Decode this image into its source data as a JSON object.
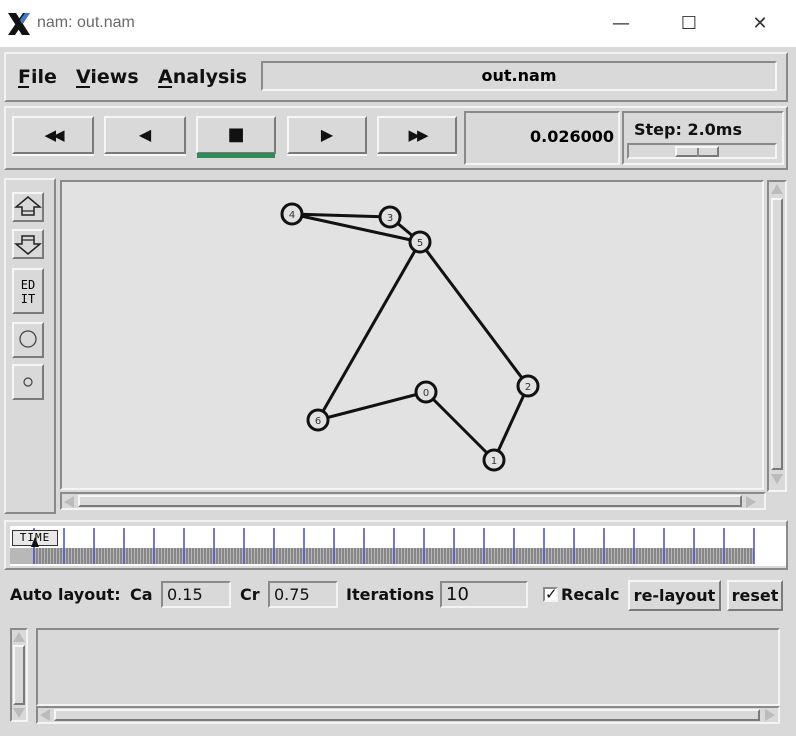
{
  "window": {
    "title": "nam: out.nam",
    "icon": "x-logo-icon",
    "minimize": "—",
    "maximize": "☐",
    "close": "✕"
  },
  "menu": {
    "file": "File",
    "views": "Views",
    "analysis": "Analysis",
    "filename": "out.nam"
  },
  "controls": {
    "rewind": "◀◀",
    "back": "◀",
    "stop": "■",
    "play": "▶",
    "fast_forward": "▶▶",
    "time": "0.026000",
    "step_label": "Step: 2.0ms",
    "step_level": 0.45,
    "active_color": "#2e8b57"
  },
  "side_tools": {
    "edit_label_1": "ED",
    "edit_label_2": "IT"
  },
  "timeline": {
    "label": "TIME"
  },
  "layout": {
    "auto_layout_label": "Auto layout:",
    "ca_label": "Ca",
    "ca_value": "0.15",
    "cr_label": "Cr",
    "cr_value": "0.75",
    "iterations_label": "Iterations",
    "iterations_value": "10",
    "recalc_label": "Recalc",
    "recalc_checked": true,
    "relayout_button": "re-layout",
    "reset_button": "reset"
  },
  "network": {
    "nodes": [
      {
        "id": "0",
        "label": "0"
      },
      {
        "id": "1",
        "label": "1"
      },
      {
        "id": "2",
        "label": "2"
      },
      {
        "id": "3",
        "label": "3"
      },
      {
        "id": "4",
        "label": "4"
      },
      {
        "id": "5",
        "label": "5"
      },
      {
        "id": "6",
        "label": "6"
      }
    ],
    "links": [
      [
        "4",
        "3"
      ],
      [
        "4",
        "5"
      ],
      [
        "3",
        "5"
      ],
      [
        "5",
        "6"
      ],
      [
        "5",
        "2"
      ],
      [
        "2",
        "1"
      ],
      [
        "1",
        "0"
      ],
      [
        "0",
        "6"
      ]
    ]
  }
}
